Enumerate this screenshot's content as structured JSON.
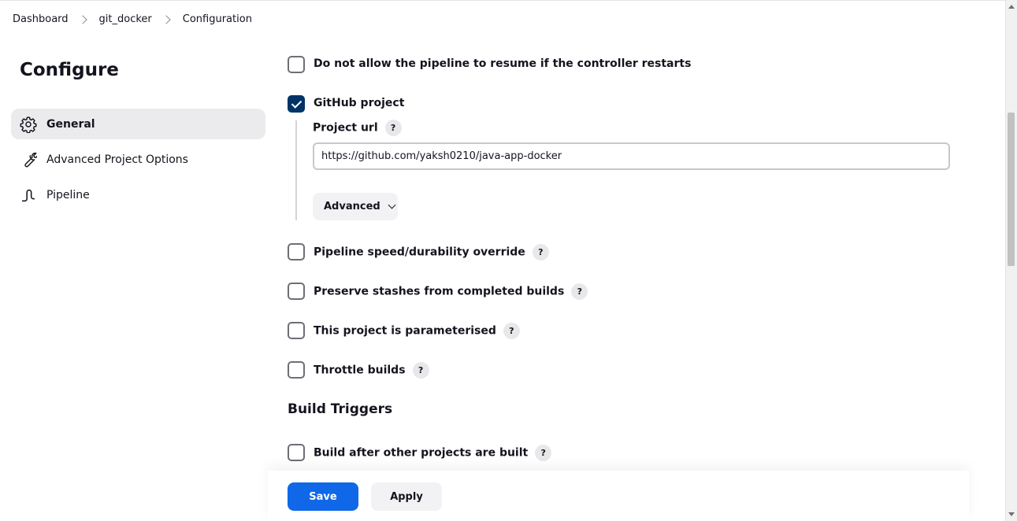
{
  "breadcrumb": {
    "items": [
      "Dashboard",
      "git_docker",
      "Configuration"
    ]
  },
  "page_title": "Configure",
  "sidebar": {
    "items": [
      {
        "label": "General",
        "icon": "gear-icon",
        "active": true
      },
      {
        "label": "Advanced Project Options",
        "icon": "wrench-icon",
        "active": false
      },
      {
        "label": "Pipeline",
        "icon": "pipeline-icon",
        "active": false
      }
    ]
  },
  "options": {
    "no_resume": {
      "label": "Do not allow the pipeline to resume if the controller restarts",
      "checked": false
    },
    "github_project": {
      "label": "GitHub project",
      "checked": true
    },
    "speed_override": {
      "label": "Pipeline speed/durability override",
      "checked": false
    },
    "preserve_stashes": {
      "label": "Preserve stashes from completed builds",
      "checked": false
    },
    "parameterised": {
      "label": "This project is parameterised",
      "checked": false
    },
    "throttle": {
      "label": "Throttle builds",
      "checked": false
    }
  },
  "github": {
    "project_url_label": "Project url",
    "project_url_value": "https://github.com/yaksh0210/java-app-docker",
    "advanced_label": "Advanced"
  },
  "build_triggers": {
    "title": "Build Triggers",
    "after_other": {
      "label": "Build after other projects are built",
      "checked": false
    }
  },
  "help_glyph": "?",
  "actions": {
    "save": "Save",
    "apply": "Apply"
  },
  "colors": {
    "accent": "#1068e8",
    "checkbox_checked": "#003366"
  }
}
